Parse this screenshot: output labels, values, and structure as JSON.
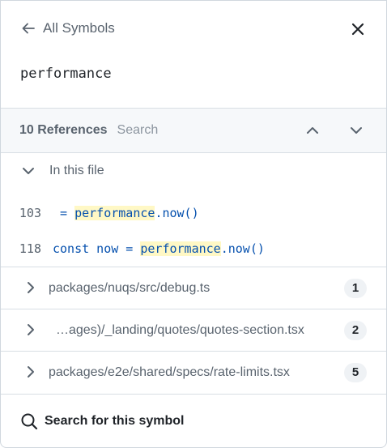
{
  "header": {
    "back_label": "All Symbols"
  },
  "symbol": {
    "name": "performance"
  },
  "references": {
    "count_label": "10 References",
    "search_label": "Search"
  },
  "in_file": {
    "label": "In this file"
  },
  "code_lines": [
    {
      "line": "103",
      "pre": " = ",
      "match": "performance",
      "post": ".now()"
    },
    {
      "line": "118",
      "pre": "const now = ",
      "match": "performance",
      "post": ".now()"
    }
  ],
  "files": [
    {
      "path": "packages/nuqs/src/debug.ts",
      "count": "1"
    },
    {
      "path": "…ages)/_landing/quotes/quotes-section.tsx",
      "count": "2"
    },
    {
      "path": "packages/e2e/shared/specs/rate-limits.tsx",
      "count": "5"
    }
  ],
  "footer": {
    "search_label": "Search for this symbol"
  },
  "colors": {
    "highlight": "#fff8c5",
    "code_blue": "#0550ae",
    "muted": "#59636e"
  }
}
